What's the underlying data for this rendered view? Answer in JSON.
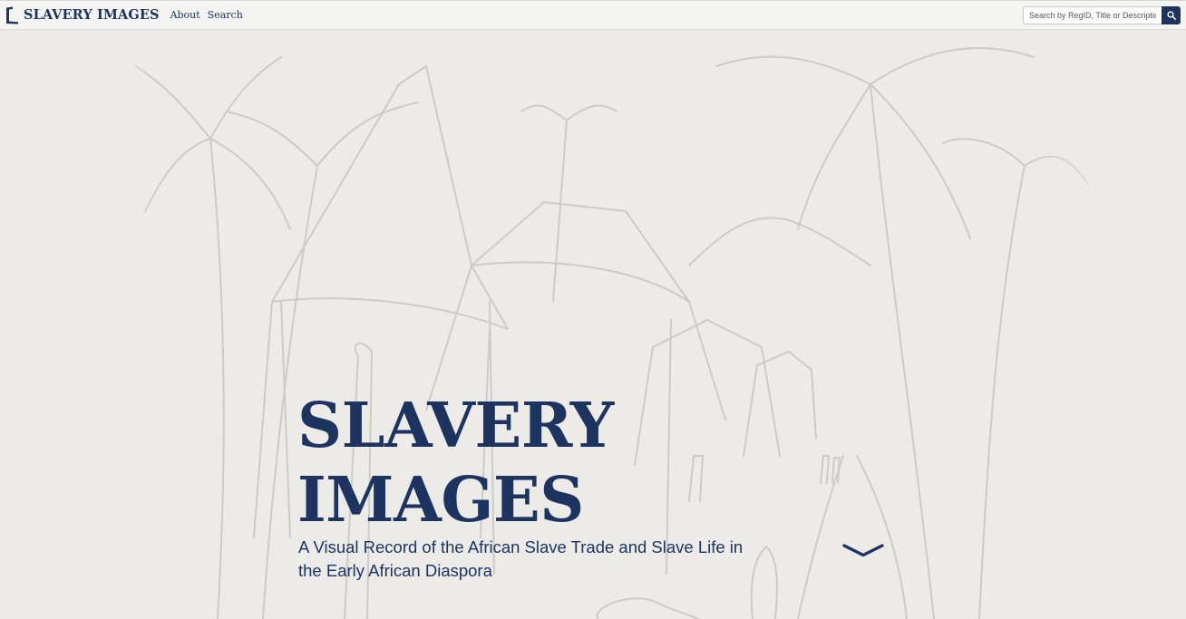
{
  "navbar": {
    "brand": "SLAVERY IMAGES",
    "links": [
      {
        "label": "About"
      },
      {
        "label": "Search"
      }
    ],
    "search": {
      "placeholder": "Search by RegID, Title or Description",
      "button_icon": "magnifier-icon"
    }
  },
  "hero": {
    "title_line1": "SLAVERY",
    "title_line2": "IMAGES",
    "subtitle": "A Visual Record of the African Slave Trade and Slave Life in the Early African Diaspora",
    "scroll_icon": "chevron-down-icon",
    "background": "faded engraving of a village with thatched huts and palm trees"
  },
  "colors": {
    "brand": "#1d3461",
    "navbar_bg": "#f4f4f3",
    "hero_bg": "#ecebe8"
  }
}
